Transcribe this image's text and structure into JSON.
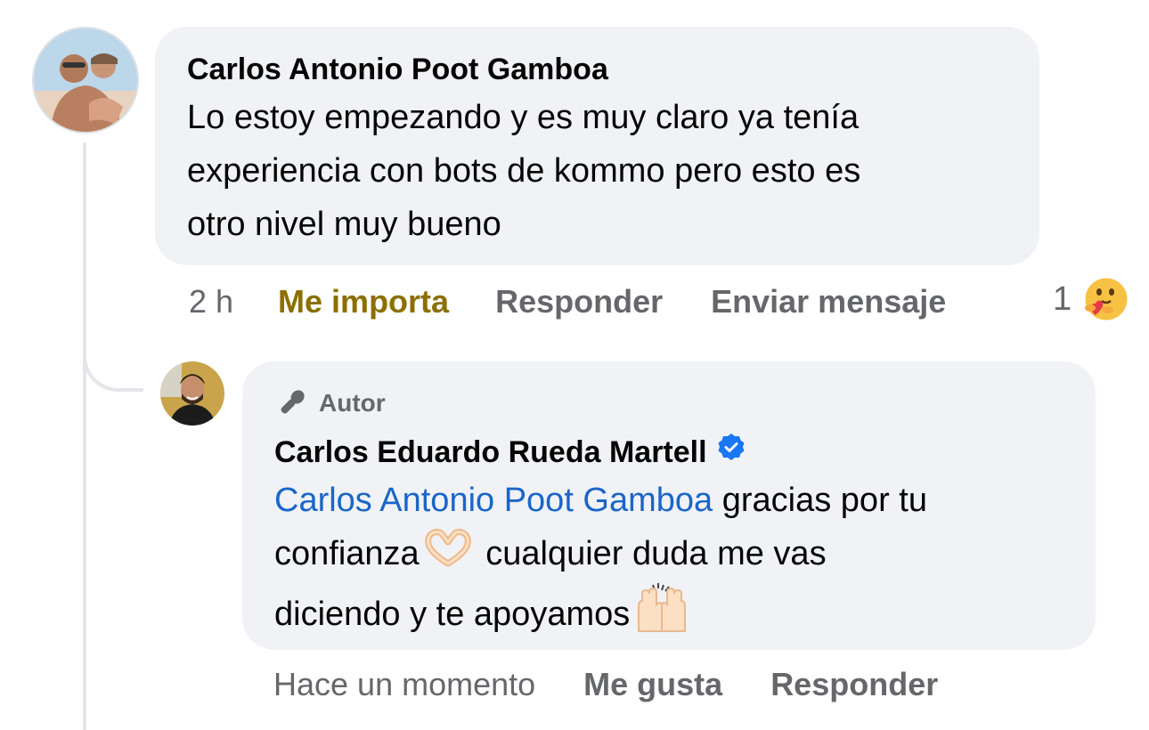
{
  "main_comment": {
    "author": "Carlos Antonio Poot Gamboa",
    "text_lines": [
      "Lo estoy empezando y es muy claro ya tenía",
      "experiencia con bots de kommo pero esto es",
      "otro nivel muy bueno"
    ],
    "time": "2 h",
    "actions": {
      "reaction": "Me importa",
      "reply": "Responder",
      "message": "Enviar mensaje"
    },
    "reaction_count": "1",
    "reaction_icon": "care-emoji-icon"
  },
  "reply_comment": {
    "badge": "Autor",
    "author": "Carlos Eduardo Rueda Martell",
    "mention": "Carlos Antonio Poot Gamboa",
    "text_part1": " gracias por tu",
    "text_part2": "confianza",
    "text_part3": " cualquier duda me vas",
    "text_part4": "diciendo y te apoyamos",
    "time": "Hace un momento",
    "actions": {
      "like": "Me gusta",
      "reply": "Responder"
    }
  },
  "colors": {
    "bubble": "#f0f2f5",
    "mention": "#1a66c9",
    "liked_reaction": "#8c6f00",
    "verified": "#1877f2",
    "meta": "#65676b"
  }
}
